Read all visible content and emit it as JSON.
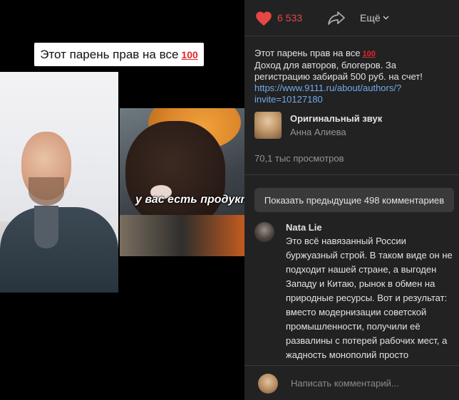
{
  "video": {
    "caption": "Этот парень прав на все",
    "caption_emoji": "100",
    "subtitle": "у вас есть продукты"
  },
  "panel": {
    "like_count": "6 533",
    "more_label": "Ещё",
    "description": {
      "line1": "Этот парень прав на все",
      "line1_emoji": "100",
      "line2": "Доход для авторов, блогеров. За регистрацию забирай 500 руб. на счет!",
      "link": "https://www.9111.ru/about/authors/?invite=10127180"
    },
    "sound": {
      "title": "Оригинальный звук",
      "author": "Анна Алиева"
    },
    "views": "70,1 тыс просмотров",
    "show_previous": "Показать предыдущие 498 комментариев",
    "comment": {
      "author": "Nata Lie",
      "text": "Это всё навязанный России буржуазный строй. В таком виде он не подходит нашей стране, а выгоден Западу и Китаю, рынок в обмен на природные ресурсы. Вот и результат: вместо модернизации советской промышленности, получили её развалины с потерей рабочих мест, а жадность монополий просто зашкаливает своей кабальной привязкой к доллару."
    },
    "composer_placeholder": "Написать комментарий...",
    "colors": {
      "like": "#e64646",
      "link": "#71aaeb",
      "panel_bg": "#222222"
    }
  }
}
